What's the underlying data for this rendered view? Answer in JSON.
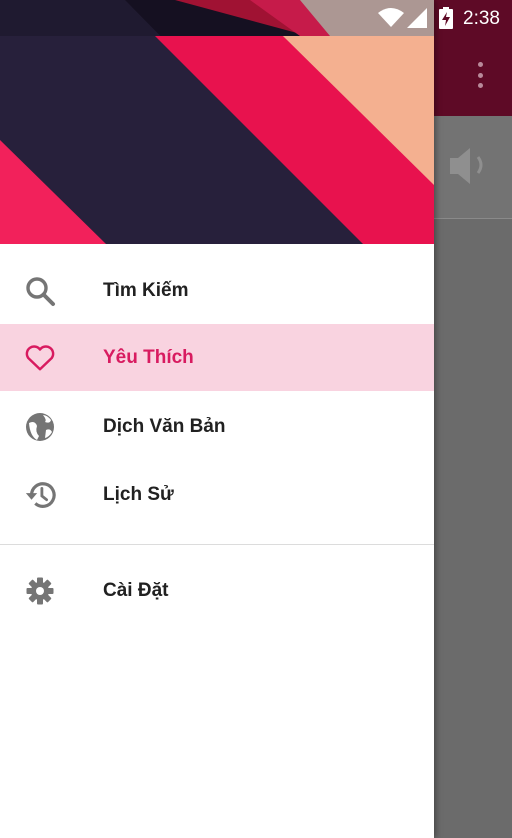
{
  "status_bar": {
    "time": "2:38"
  },
  "drawer": {
    "menu": [
      {
        "label": "Tìm Kiếm",
        "icon": "search-icon",
        "active": false
      },
      {
        "label": "Yêu Thích",
        "icon": "heart-icon",
        "active": true
      },
      {
        "label": "Dịch Văn Bản",
        "icon": "globe-icon",
        "active": false
      },
      {
        "label": "Lịch Sử",
        "icon": "history-icon",
        "active": false
      }
    ],
    "settings": {
      "label": "Cài Đặt",
      "icon": "gear-icon"
    }
  },
  "background_app": {
    "icons": [
      "more-vert-icon",
      "speaker-icon"
    ]
  },
  "colors": {
    "accent": "#d81b60",
    "active_bg": "#f9d3e0",
    "header_dark": "#27203b",
    "header_pink": "#f2215b",
    "header_peach": "#f4b090"
  }
}
